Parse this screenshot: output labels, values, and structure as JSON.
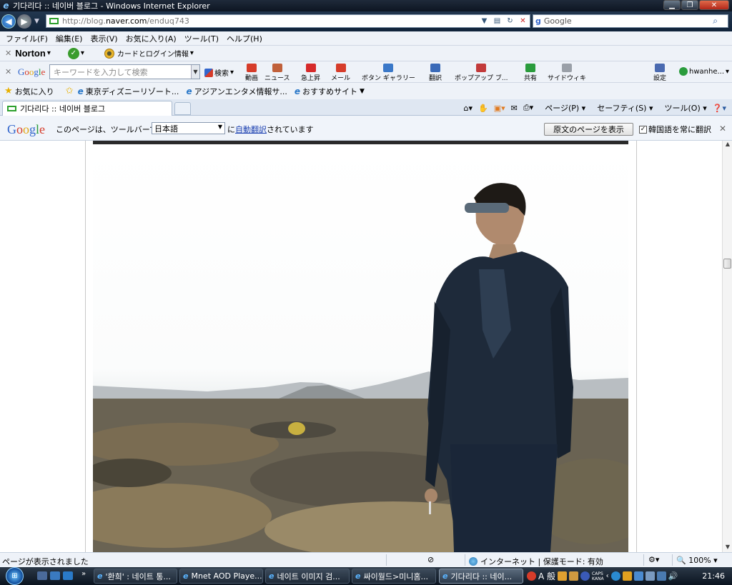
{
  "window": {
    "title": "기다리다 :: 네이버 블로그 - Windows Internet Explorer"
  },
  "address_bar": {
    "url_prefix": "http://blog.",
    "url_domain": "naver.com",
    "url_suffix": "/enduq743",
    "search_label": "Google"
  },
  "menu": [
    "ファイル(F)",
    "編集(E)",
    "表示(V)",
    "お気に入り(A)",
    "ツール(T)",
    "ヘルプ(H)"
  ],
  "norton_bar": {
    "brand": "Norton",
    "card_login": "カードとログイン情報"
  },
  "google_toolbar": {
    "search_placeholder": "キーワードを入力して検索",
    "search_btn": "検索",
    "tools": [
      {
        "label": "動画",
        "color": "#d63c2a"
      },
      {
        "label": "ニュース",
        "color": "#c0603a"
      },
      {
        "label": "急上昇",
        "color": "#d62a2a"
      },
      {
        "label": "メール",
        "color": "#d63c2a"
      },
      {
        "label": "ボタン ギャラリー",
        "color": "#3a78c8"
      },
      {
        "label": "翻訳",
        "color": "#3a6ab8"
      },
      {
        "label": "ポップアップ ブ...",
        "color": "#c23a3a"
      },
      {
        "label": "共有",
        "color": "#2a9c3c"
      },
      {
        "label": "サイドウィキ",
        "color": "#9aa0a8"
      },
      {
        "label": "設定",
        "color": "#4a6ab0"
      }
    ],
    "user": "hwanhe..."
  },
  "favorites": {
    "label": "お気に入り",
    "items": [
      "東京ディズニーリゾート...",
      "アジアンエンタメ情報サ...",
      "おすすめサイト"
    ]
  },
  "tab": {
    "title": "기다리다 :: 네이버 블로그"
  },
  "command_bar": {
    "page": "ページ(P)",
    "safety": "セーフティ(S)",
    "tools": "ツール(O)"
  },
  "translate_bar": {
    "message_before": "このページは、ツールバーで",
    "language": "日本語",
    "message_mid": "に",
    "link": "自動翻訳",
    "message_after": "されています",
    "original_button": "原文のページを表示",
    "always_translate": "韓国語を常に翻訳",
    "always_checked": true
  },
  "status_bar": {
    "status": "ページが表示されました",
    "zone": "インターネット | 保護モード: 有効",
    "zoom": "100%"
  },
  "taskbar": {
    "buttons": [
      {
        "label": "'환희' : 네이트 통...",
        "active": false
      },
      {
        "label": "Mnet AOD Playe...",
        "active": false
      },
      {
        "label": "네이트 이미지 검...",
        "active": false
      },
      {
        "label": "싸이월드>미니홈...",
        "active": false
      },
      {
        "label": "기다리다 :: 네이...",
        "active": true
      }
    ],
    "ime": "A 般",
    "caps": "CAPS",
    "kana": "KANA",
    "clock": "21:46"
  },
  "colors": {
    "titlebar": "#0d1522",
    "accent_link": "#1a3fb0",
    "toolbar_bg": "#eef2f8"
  }
}
